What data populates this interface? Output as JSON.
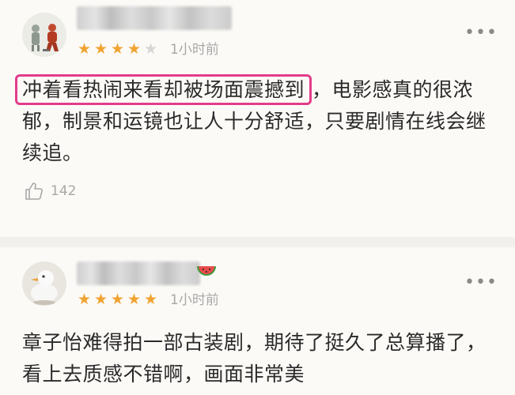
{
  "reviews": [
    {
      "rating": 4,
      "max_rating": 5,
      "time": "1小时前",
      "more_icon": "more-dots-icon",
      "highlighted_text": "冲着看热闹来看却被场面震撼到",
      "text_rest": "，电影感真的很浓郁，制景和运镜也让人十分舒适，只要剧情在线会继续追。",
      "likes": "142",
      "highlight_color": "#e23c8a"
    },
    {
      "rating": 5,
      "max_rating": 5,
      "time": "1小时前",
      "more_icon": "more-dots-icon",
      "text": "章子怡难得拍一部古装剧，期待了挺久了总算播了，看上去质感不错啊，画面非常美"
    }
  ],
  "colors": {
    "star_on": "#f0a331",
    "star_off": "#d6d6d6",
    "meta_text": "#a8a8a8",
    "background": "#fcfaf7"
  }
}
